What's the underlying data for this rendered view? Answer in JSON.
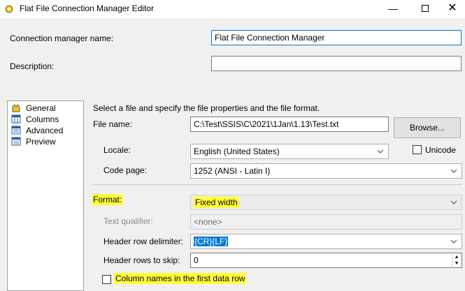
{
  "window": {
    "title": "Flat File Connection Manager Editor",
    "minimize": "—",
    "close": "✕"
  },
  "connection_name": {
    "label": "Connection manager name:",
    "value": "Flat File Connection Manager"
  },
  "description": {
    "label": "Description:",
    "value": ""
  },
  "nav": {
    "items": [
      {
        "label": "General",
        "icon": "general-icon"
      },
      {
        "label": "Columns",
        "icon": "columns-icon"
      },
      {
        "label": "Advanced",
        "icon": "advanced-icon"
      },
      {
        "label": "Preview",
        "icon": "preview-icon"
      }
    ]
  },
  "general": {
    "intro": "Select a file and specify the file properties and the file format.",
    "file_name_label": "File name:",
    "file_name_value": "C:\\Test\\SSIS\\C\\2021\\1Jan\\1.13\\Test.txt",
    "browse_label": "Browse...",
    "locale_label": "Locale:",
    "locale_value": "English (United States)",
    "unicode_label": "Unicode",
    "code_page_label": "Code page:",
    "code_page_value": "1252  (ANSI - Latin I)",
    "format_label": "Format:",
    "format_value": "Fixed width",
    "text_qualifier_label": "Text qualifier:",
    "text_qualifier_value": "<none>",
    "header_delim_label": "Header row delimiter:",
    "header_delim_value": "{CR}{LF}",
    "header_skip_label": "Header rows to skip:",
    "header_skip_value": "0",
    "column_names_label": "Column names in the first data row"
  },
  "colors": {
    "highlight": "#ffff3c",
    "selection": "#0078d7"
  }
}
